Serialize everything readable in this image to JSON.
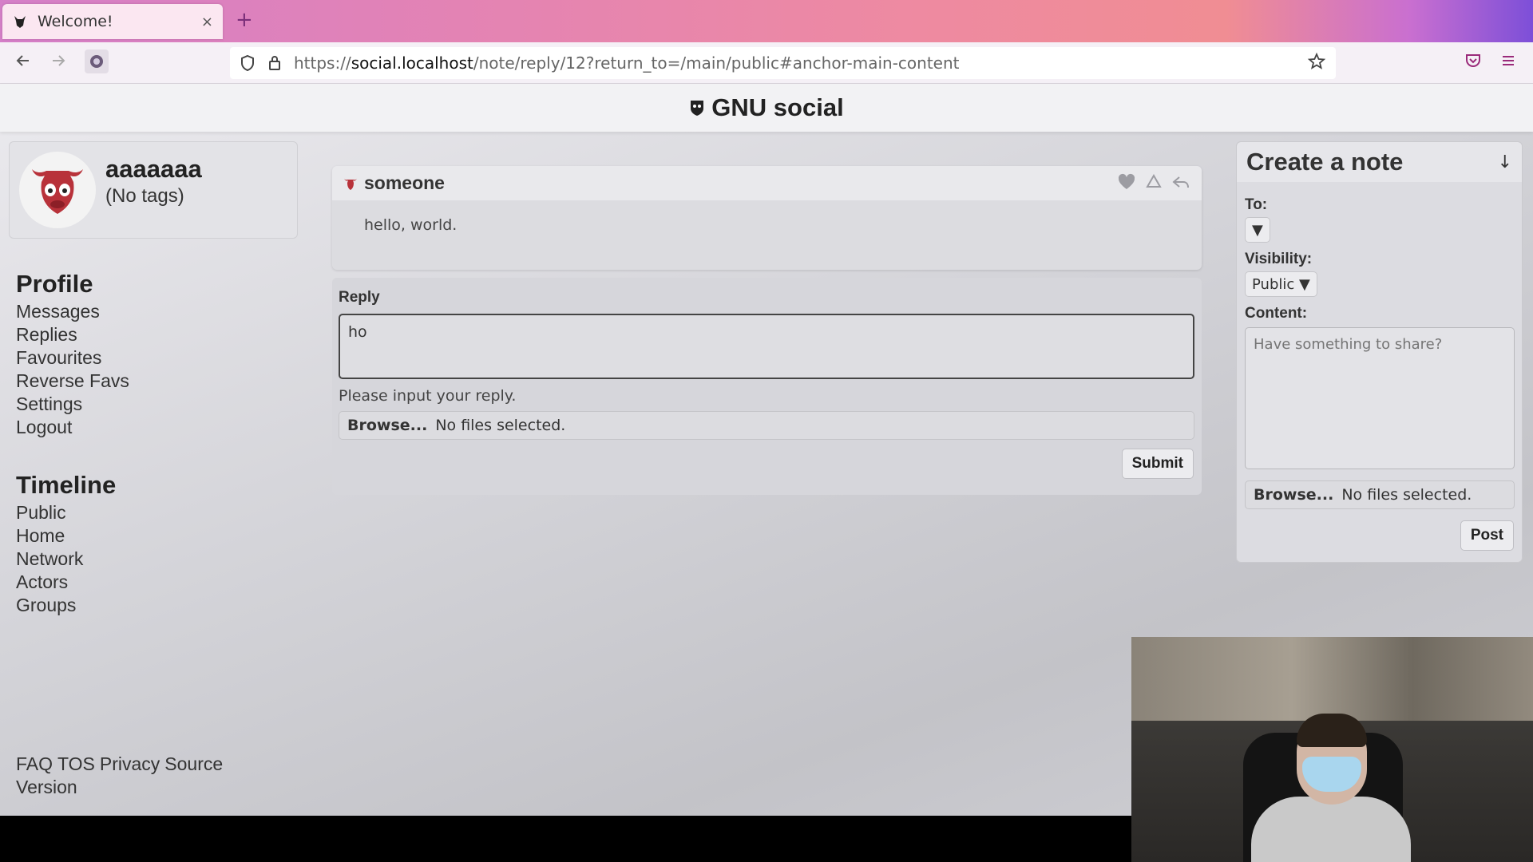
{
  "browser": {
    "tab_title": "Welcome!",
    "new_tab_symbol": "+",
    "tab_close_symbol": "×",
    "url_prefix": "https://",
    "url_host": "social.localhost",
    "url_path": "/note/reply/12?return_to=/main/public#anchor-main-content"
  },
  "site": {
    "title": "GNU social",
    "accent_color": "#b8323a"
  },
  "profile": {
    "name": "aaaaaaa",
    "tags": "(No tags)"
  },
  "nav": {
    "profile_heading": "Profile",
    "profile_links": [
      "Messages",
      "Replies",
      "Favourites",
      "Reverse Favs",
      "Settings",
      "Logout"
    ],
    "timeline_heading": "Timeline",
    "timeline_links": [
      "Public",
      "Home",
      "Network",
      "Actors",
      "Groups"
    ]
  },
  "footer": {
    "links": [
      "FAQ",
      "TOS",
      "Privacy",
      "Source"
    ],
    "version": "Version"
  },
  "note": {
    "author": "someone",
    "content": "hello, world."
  },
  "reply": {
    "label": "Reply",
    "value": "ho",
    "hint": "Please input your reply.",
    "browse_label": "Browse...",
    "no_files": "No files selected.",
    "submit_label": "Submit"
  },
  "create_note": {
    "title": "Create a note",
    "toggle_symbol": "↓",
    "to_label": "To:",
    "to_value": "▼",
    "visibility_label": "Visibility:",
    "visibility_value": "Public ▼",
    "content_label": "Content:",
    "content_placeholder": "Have something to share?",
    "browse_label": "Browse...",
    "no_files": "No files selected.",
    "post_label": "Post"
  }
}
